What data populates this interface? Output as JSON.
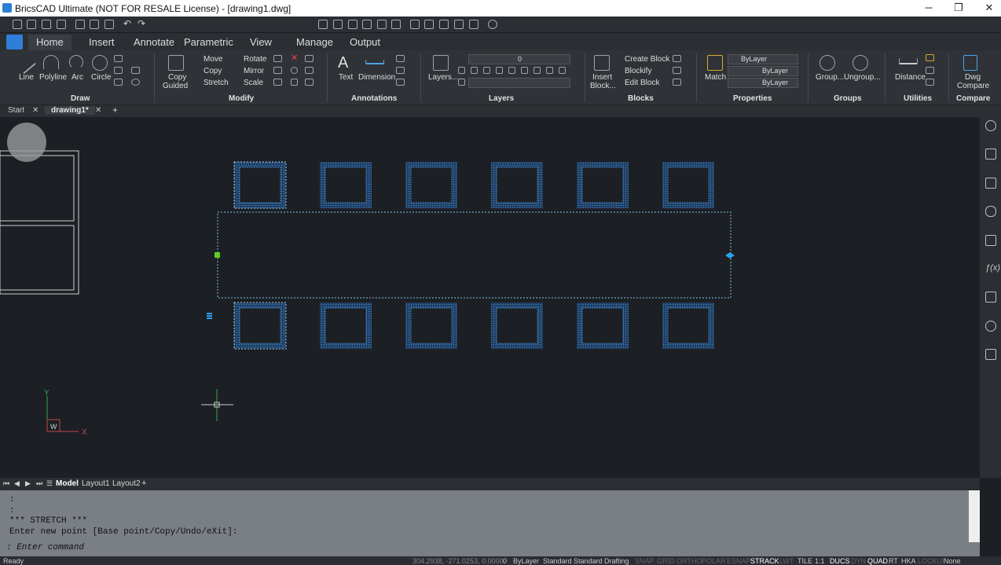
{
  "window": {
    "title": "BricsCAD Ultimate (NOT FOR RESALE License) - [drawing1.dwg]",
    "minimize": "─",
    "restore": "❐",
    "close": "✕"
  },
  "qat": {
    "layer_value": "0"
  },
  "ribbon_tabs": [
    "Home",
    "Insert",
    "Annotate",
    "Parametric",
    "View",
    "Manage",
    "Output"
  ],
  "ribbon": {
    "draw": {
      "name": "Draw",
      "line": "Line",
      "polyline": "Polyline",
      "arc": "Arc",
      "circle": "Circle"
    },
    "modify": {
      "name": "Modify",
      "copy": "Copy",
      "guided": "Guided",
      "move": "Move",
      "copy2": "Copy",
      "stretch": "Stretch",
      "rotate": "Rotate",
      "mirror": "Mirror",
      "scale": "Scale"
    },
    "annotations": {
      "name": "Annotations",
      "text": "Text",
      "dimension": "Dimension"
    },
    "layers": {
      "name": "Layers",
      "layers_btn": "Layers...",
      "layer_value": "0"
    },
    "blocks": {
      "name": "Blocks",
      "insert": "Insert",
      "block": "Block...",
      "create": "Create Block",
      "blockify": "Blockify",
      "edit": "Edit Block"
    },
    "properties": {
      "name": "Properties",
      "match": "Match",
      "color": "ByLayer",
      "linetype": "ByLayer",
      "lineweight": "ByLayer"
    },
    "groups": {
      "name": "Groups",
      "group": "Group...",
      "ungroup": "Ungroup..."
    },
    "utilities": {
      "name": "Utilities",
      "distance": "Distance"
    },
    "compare": {
      "name": "Compare",
      "dwg": "Dwg",
      "compare": "Compare"
    }
  },
  "doc_tabs": {
    "start": "Start",
    "drawing": "drawing1*",
    "add": "+"
  },
  "layout_tabs": {
    "model": "Model",
    "layout1": "Layout1",
    "layout2": "Layout2",
    "add": "+"
  },
  "ucs": {
    "x": "X",
    "y": "Y",
    "w": "W"
  },
  "command": {
    "line1": ":",
    "line2": ":",
    "line3": "*** STRETCH ***",
    "line4": "Enter new point [Base point/Copy/Undo/eXit]:",
    "prompt": ": Enter command"
  },
  "status": {
    "ready": "Ready",
    "coords": "304.2938, -271.0253, 0.0000",
    "items": [
      "0",
      "ByLayer",
      "Standard",
      "Standard",
      "Drafting",
      "SNAP",
      "GRID",
      "ORTHO",
      "POLAR",
      "ESNAP",
      "STRACK",
      "LWT",
      "TILE",
      "1:1",
      "DUCS",
      "DYN",
      "QUAD",
      "RT",
      "HKA",
      "LOCKUI",
      "None"
    ]
  },
  "colors": {
    "selection": "#3b86c4",
    "grip_green": "#5fcf1f",
    "grip_blue": "#2ea0f0"
  }
}
